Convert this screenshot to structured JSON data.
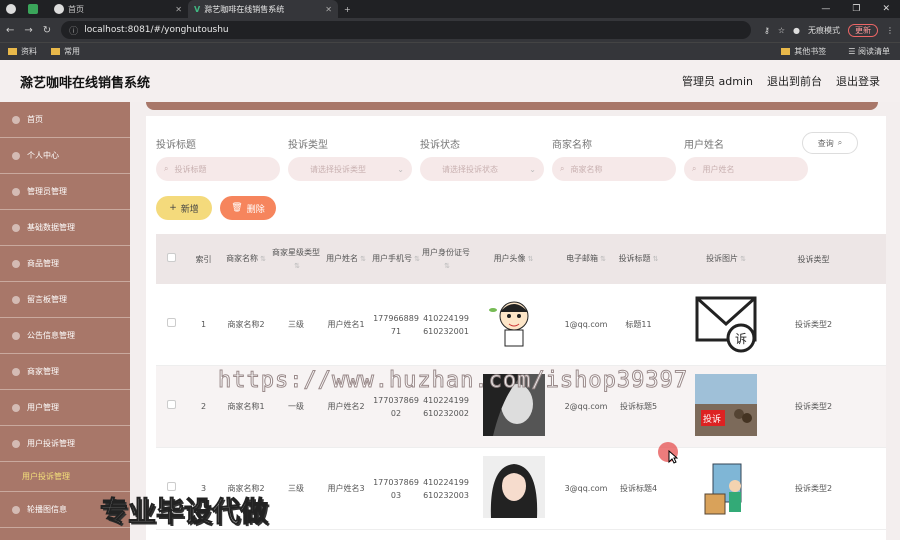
{
  "browser": {
    "tabs": [
      {
        "label": ""
      },
      {
        "label": ""
      },
      {
        "label": "首页"
      },
      {
        "label": "滁艺咖啡在线销售系统"
      }
    ],
    "url": "localhost:8081/#/yonghutoushu",
    "profile": "无痕模式",
    "update": "更新",
    "bookmarks": [
      "资料",
      "常用"
    ],
    "bookmarks_right": [
      "其他书签",
      "阅读清单"
    ]
  },
  "app": {
    "title": "滁艺咖啡在线销售系统",
    "admin_label": "管理员 admin",
    "back_front": "退出到前台",
    "logout": "退出登录"
  },
  "sidebar": {
    "items": [
      {
        "label": "首页"
      },
      {
        "label": "个人中心"
      },
      {
        "label": "管理员管理"
      },
      {
        "label": "基础数据管理"
      },
      {
        "label": "商品管理"
      },
      {
        "label": "留言板管理"
      },
      {
        "label": "公告信息管理"
      },
      {
        "label": "商家管理"
      },
      {
        "label": "用户管理"
      },
      {
        "label": "用户投诉管理"
      }
    ],
    "sub_item": "用户投诉管理",
    "last_item": "轮播图信息"
  },
  "filters": [
    {
      "label": "投诉标题",
      "placeholder": "投诉标题"
    },
    {
      "label": "投诉类型",
      "placeholder": "请选择投诉类型"
    },
    {
      "label": "投诉状态",
      "placeholder": "请选择投诉状态"
    },
    {
      "label": "商家名称",
      "placeholder": "商家名称"
    },
    {
      "label": "用户姓名",
      "placeholder": "用户姓名"
    }
  ],
  "buttons": {
    "query": "查询",
    "add": "新增",
    "delete": "删除"
  },
  "table": {
    "headers": [
      "索引",
      "商家名称",
      "商家星级类型",
      "用户姓名",
      "用户手机号",
      "用户身份证号",
      "用户头像",
      "电子邮箱",
      "投诉标题",
      "投诉图片",
      "投诉类型"
    ],
    "rows": [
      {
        "index": "1",
        "shop": "商家名称2",
        "level": "三级",
        "name": "用户姓名1",
        "phone": "17796688971",
        "idcard": "410224199610232001",
        "email": "1@qq.com",
        "title": "标题11",
        "type": "投诉类型2"
      },
      {
        "index": "2",
        "shop": "商家名称1",
        "level": "一级",
        "name": "用户姓名2",
        "phone": "17703786902",
        "idcard": "410224199610232002",
        "email": "2@qq.com",
        "title": "投诉标题5",
        "type": "投诉类型2"
      },
      {
        "index": "3",
        "shop": "商家名称2",
        "level": "三级",
        "name": "用户姓名3",
        "phone": "17703786903",
        "idcard": "410224199610232003",
        "email": "3@qq.com",
        "title": "投诉标题4",
        "type": "投诉类型2"
      }
    ]
  },
  "overlay": {
    "watermark": "https://www.huzhan.com/ishop39397",
    "promo": "专业毕设代做"
  }
}
